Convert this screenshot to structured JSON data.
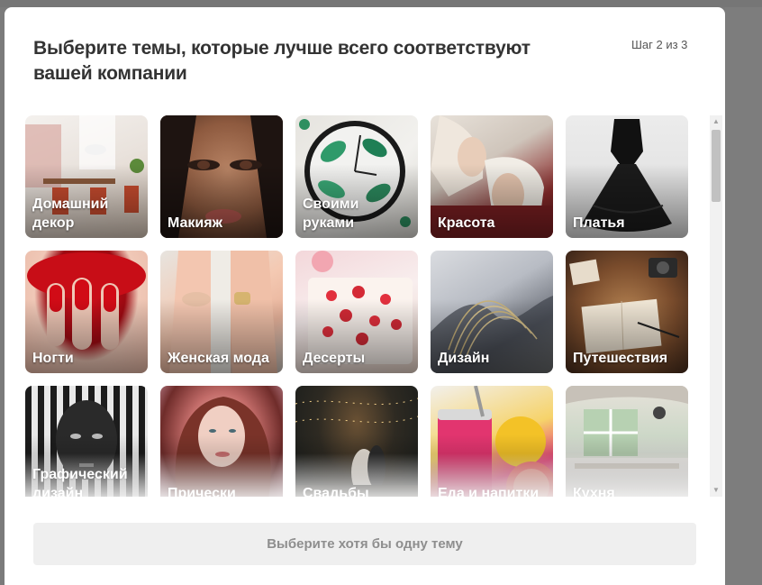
{
  "dialog": {
    "title": "Выберите темы, которые лучше всего соответствуют вашей компании",
    "step": "Шаг 2 из 3",
    "submit_label": "Выберите хотя бы одну тему"
  },
  "topics": [
    {
      "label": "Домашний декор",
      "image": "home-decor-image"
    },
    {
      "label": "Макияж",
      "image": "makeup-image"
    },
    {
      "label": "Своими руками",
      "image": "diy-image"
    },
    {
      "label": "Красота",
      "image": "beauty-image"
    },
    {
      "label": "Платья",
      "image": "dresses-image"
    },
    {
      "label": "Ногти",
      "image": "nails-image"
    },
    {
      "label": "Женская мода",
      "image": "womens-fashion-image"
    },
    {
      "label": "Десерты",
      "image": "desserts-image"
    },
    {
      "label": "Дизайн",
      "image": "design-image"
    },
    {
      "label": "Путешествия",
      "image": "travel-image"
    },
    {
      "label": "Графический дизайн",
      "image": "graphic-design-image"
    },
    {
      "label": "Прически",
      "image": "hairstyles-image"
    },
    {
      "label": "Свадьбы",
      "image": "weddings-image"
    },
    {
      "label": "Еда и напитки",
      "image": "food-drinks-image"
    },
    {
      "label": "Кухня",
      "image": "kitchen-image"
    }
  ],
  "scrollbar": {
    "up_icon": "scroll-up-arrow-icon",
    "down_icon": "scroll-down-arrow-icon"
  }
}
